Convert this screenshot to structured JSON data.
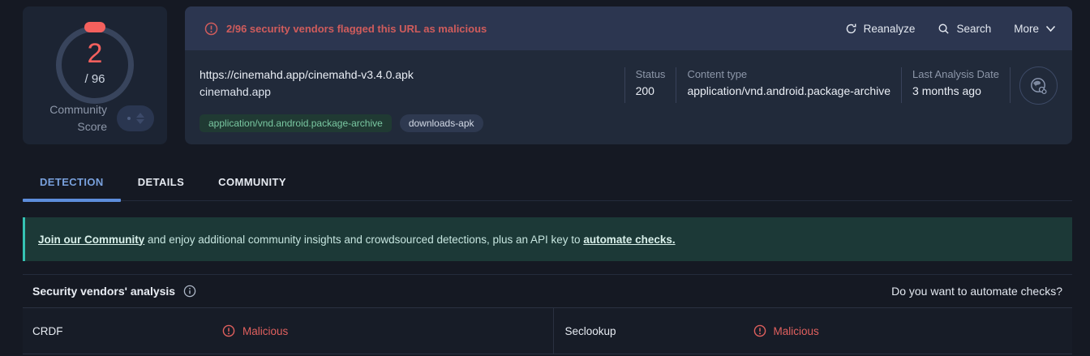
{
  "score_panel": {
    "score": "2",
    "total": "/ 96",
    "community_label_line1": "Community",
    "community_label_line2": "Score"
  },
  "alert": {
    "text": "2/96 security vendors flagged this URL as malicious"
  },
  "toolbar": {
    "reanalyze": "Reanalyze",
    "search": "Search",
    "more": "More"
  },
  "url_info": {
    "url": "https://cinemahd.app/cinemahd-v3.4.0.apk",
    "domain": "cinemahd.app",
    "status_label": "Status",
    "status_value": "200",
    "content_type_label": "Content type",
    "content_type_value": "application/vnd.android.package-archive",
    "last_analysis_label": "Last Analysis Date",
    "last_analysis_value": "3 months ago",
    "tags": [
      "application/vnd.android.package-archive",
      "downloads-apk"
    ]
  },
  "tabs": [
    {
      "label": "DETECTION",
      "active": true
    },
    {
      "label": "DETAILS",
      "active": false
    },
    {
      "label": "COMMUNITY",
      "active": false
    }
  ],
  "community_banner": {
    "link_join": "Join our Community",
    "middle": " and enjoy additional community insights and crowdsourced detections, plus an API key to ",
    "link_automate": "automate checks."
  },
  "analysis": {
    "title": "Security vendors' analysis",
    "automate_prompt": "Do you want to automate checks?",
    "rows": [
      {
        "vendor": "CRDF",
        "result": "Malicious"
      },
      {
        "vendor": "Seclookup",
        "result": "Malicious"
      }
    ]
  },
  "icons": {
    "warning-icon": "circle-exclamation",
    "reanalyze-icon": "refresh-arrow",
    "search-icon": "magnifier",
    "more-chevron-icon": "chevron-down",
    "info-icon": "circle-i",
    "url-globe-icon": "globe-link",
    "malicious-icon": "circle-exclamation",
    "vote-up-icon": "caret-up",
    "vote-down-icon": "caret-down"
  },
  "colors": {
    "danger": "#e0605e",
    "teal_accent": "#35c3b4",
    "tab_active": "#79a1dd",
    "tag_green": "#7ac8a2",
    "score_red": "#f4605d"
  }
}
